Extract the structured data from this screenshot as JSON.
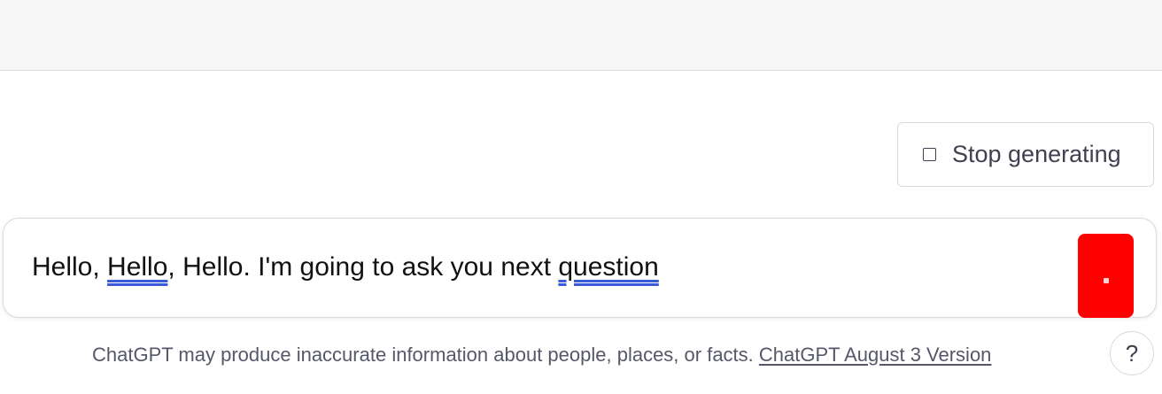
{
  "controls": {
    "stop_label": "Stop generating",
    "stop_icon": "stop-square-icon",
    "send_icon": "send-icon",
    "send_color": "#ff0000"
  },
  "composer": {
    "parts": [
      "Hello, ",
      "Hello",
      ", Hello. I'm going to ask you next ",
      "question"
    ]
  },
  "footer": {
    "disclaimer": "ChatGPT may produce inaccurate information about people, places, or facts. ",
    "version_link": "ChatGPT August 3 Version",
    "help_label": "?"
  }
}
